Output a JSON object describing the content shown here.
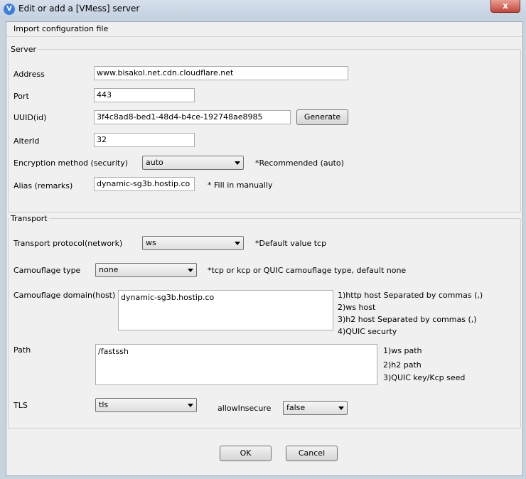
{
  "window": {
    "title": "Edit or add a [VMess] server",
    "close_label": "x",
    "app_icon_glyph": "V"
  },
  "menu": {
    "import_label": "Import configuration file"
  },
  "server": {
    "group_label": "Server",
    "address_label": "Address",
    "address_value": "www.bisakol.net.cdn.cloudflare.net",
    "port_label": "Port",
    "port_value": "443",
    "uuid_label": "UUID(id)",
    "uuid_value": "3f4c8ad8-bed1-48d4-b4ce-192748ae8985",
    "generate_label": "Generate",
    "alterid_label": "AlterId",
    "alterid_value": "32",
    "encryption_label": "Encryption method (security)",
    "encryption_value": "auto",
    "encryption_hint": "*Recommended (auto)",
    "alias_label": "Alias (remarks)",
    "alias_value": "dynamic-sg3b.hostip.co",
    "alias_hint": "* Fill in manually"
  },
  "transport": {
    "group_label": "Transport",
    "protocol_label": "Transport protocol(network)",
    "protocol_value": "ws",
    "protocol_hint": "*Default value tcp",
    "camouflage_type_label": "Camouflage type",
    "camouflage_type_value": "none",
    "camouflage_type_hint": "*tcp or kcp or QUIC camouflage type, default none",
    "camouflage_domain_label": "Camouflage domain(host)",
    "camouflage_domain_value": "dynamic-sg3b.hostip.co",
    "domain_hints": [
      "1)http host Separated by commas (,)",
      "2)ws host",
      "3)h2 host Separated by commas (,)",
      "4)QUIC securty"
    ],
    "path_label": "Path",
    "path_value": "/fastssh",
    "path_hints": [
      "1)ws path",
      "2)h2 path",
      "3)QUIC key/Kcp seed"
    ],
    "tls_label": "TLS",
    "tls_value": "tls",
    "allow_insecure_label": "allowInsecure",
    "allow_insecure_value": "false"
  },
  "footer": {
    "ok_label": "OK",
    "cancel_label": "Cancel"
  }
}
